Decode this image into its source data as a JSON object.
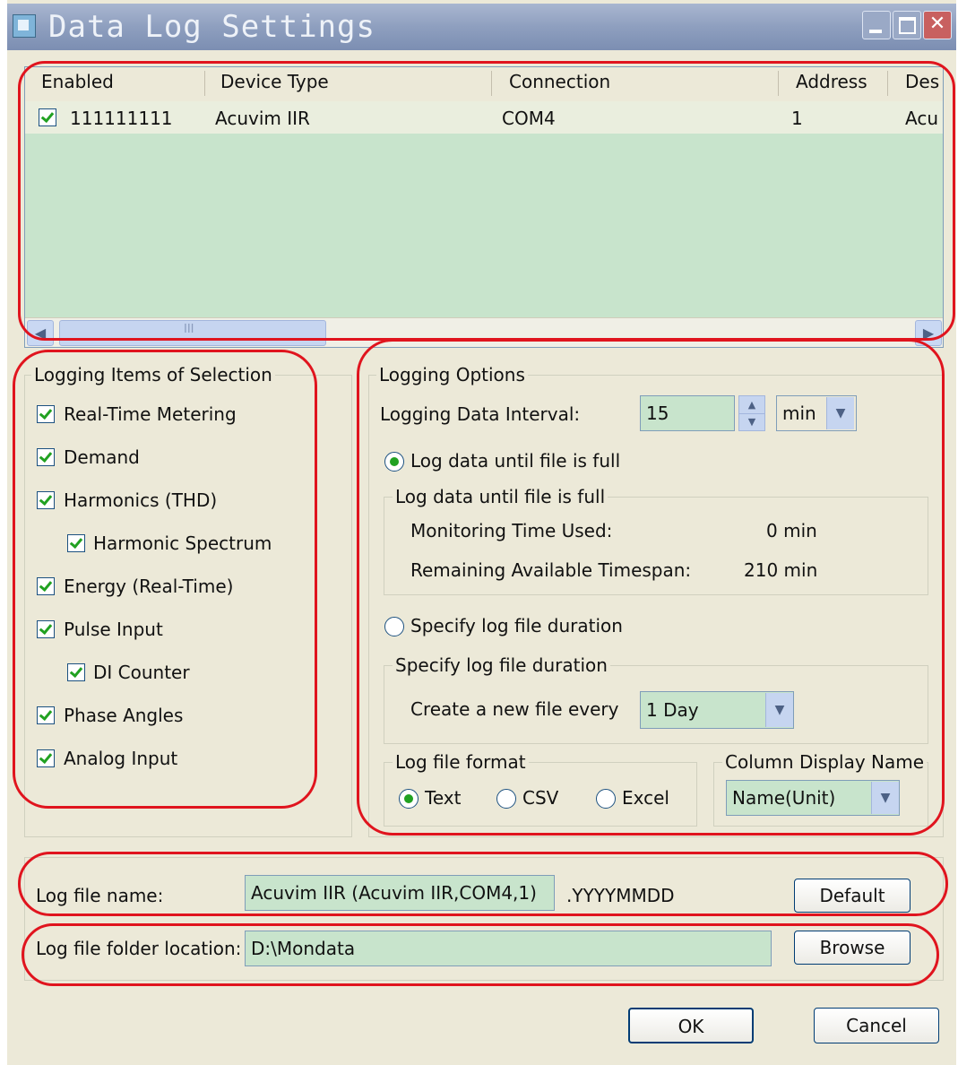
{
  "window": {
    "title": "Data Log Settings"
  },
  "device_table": {
    "columns": [
      "Enabled",
      "Device Type",
      "Connection",
      "Address",
      "Des"
    ],
    "rows": [
      {
        "enabled": true,
        "name": "111111111",
        "device_type": "Acuvim IIR",
        "connection": "COM4",
        "address": "1",
        "description": "Acu"
      }
    ],
    "scrollbar_grip": "III"
  },
  "logging_items": {
    "title": "Logging Items of Selection",
    "items": [
      {
        "label": "Real-Time Metering",
        "checked": true
      },
      {
        "label": "Demand",
        "checked": true
      },
      {
        "label": "Harmonics (THD)",
        "checked": true
      },
      {
        "label": "Harmonic Spectrum",
        "checked": true
      },
      {
        "label": "Energy (Real-Time)",
        "checked": true
      },
      {
        "label": "Pulse Input",
        "checked": true
      },
      {
        "label": "DI Counter",
        "checked": true
      },
      {
        "label": "Phase Angles",
        "checked": true
      },
      {
        "label": "Analog Input",
        "checked": true
      }
    ]
  },
  "logging_options": {
    "title": "Logging Options",
    "interval_label": "Logging Data Interval:",
    "interval_value": "15",
    "interval_unit": "min",
    "radio_until_full": "Log data until file is full",
    "group_until_full": {
      "title": "Log data until file is full",
      "time_used_label": "Monitoring Time Used:",
      "time_used_value": "0 min",
      "remaining_label": "Remaining Available Timespan:",
      "remaining_value": "210 min"
    },
    "radio_duration": "Specify log file duration",
    "group_duration": {
      "title": "Specify log file duration",
      "new_file_label": "Create a new file every",
      "new_file_value": "1 Day"
    },
    "format": {
      "title": "Log file format",
      "options": [
        "Text",
        "CSV",
        "Excel"
      ],
      "selected": "Text"
    },
    "column_display": {
      "title": "Column Display Name",
      "value": "Name(Unit)"
    }
  },
  "file_settings": {
    "name_label": "Log file name:",
    "name_value": "Acuvim IIR (Acuvim IIR,COM4,1)",
    "name_suffix": ".YYYYMMDD",
    "default_button": "Default",
    "folder_label": "Log file folder location:",
    "folder_value": "D:\\Mondata",
    "browse_button": "Browse"
  },
  "dialog_buttons": {
    "ok": "OK",
    "cancel": "Cancel"
  },
  "colors": {
    "highlight_outline": "#e0141e",
    "field_bg": "#c8e4cc",
    "dialog_bg": "#ece9d8"
  }
}
